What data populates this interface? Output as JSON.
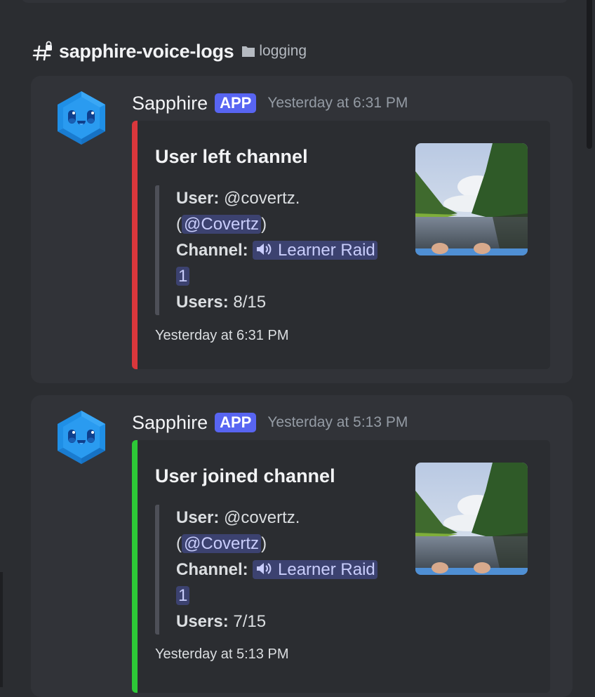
{
  "channel": {
    "name": "sapphire-voice-logs",
    "category": "logging",
    "icon": "locked-hash-icon",
    "category_icon": "folder-icon"
  },
  "colors": {
    "left_event": "#da373c",
    "joined_event": "#2dc937",
    "app_badge": "#5865f2",
    "mention_bg": "#3c4270"
  },
  "messages": [
    {
      "author": "Sapphire",
      "badge": "APP",
      "timestamp": "Yesterday at 6:31 PM",
      "embed": {
        "title": "User left channel",
        "user_label": "User:",
        "user_value": "@covertz.",
        "user_open": "(",
        "user_mention": "@Covertz",
        "user_close": ")",
        "channel_label": "Channel:",
        "channel_mention": "Learner Raid 1",
        "users_label": "Users:",
        "users_value": "8/15",
        "footer": "Yesterday at 6:31 PM",
        "thumbnail": "river-kayak-photo"
      }
    },
    {
      "author": "Sapphire",
      "badge": "APP",
      "timestamp": "Yesterday at 5:13 PM",
      "embed": {
        "title": "User joined channel",
        "user_label": "User:",
        "user_value": "@covertz.",
        "user_open": "(",
        "user_mention": "@Covertz",
        "user_close": ")",
        "channel_label": "Channel:",
        "channel_mention": "Learner Raid 1",
        "users_label": "Users:",
        "users_value": "7/15",
        "footer": "Yesterday at 5:13 PM",
        "thumbnail": "river-kayak-photo"
      }
    }
  ]
}
